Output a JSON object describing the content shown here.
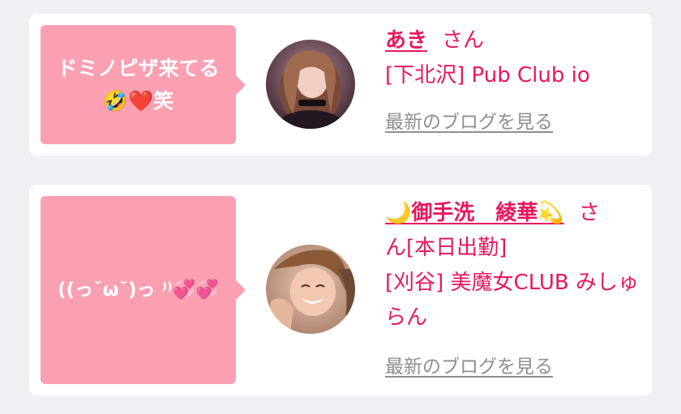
{
  "cards": [
    {
      "message": "ドミノピザ来てる\n🤣❤️笑",
      "name": "あき",
      "honorific": "さん",
      "shop": "[下北沢] Pub Club io",
      "blog_link": "最新のブログを見る",
      "avatar_icon": "woman-portrait-photo"
    },
    {
      "message": "((っ˘ω˘)っ‪ ⁾⁾💞💞",
      "name": "🌙御手洗　綾華💫",
      "honorific": "さ",
      "name_cont": "ん[本日出勤]",
      "shop": "[刈谷] 美魔女CLUB みしゅらん",
      "blog_link": "最新のブログを見る",
      "avatar_icon": "smiling-woman-photo"
    }
  ],
  "colors": {
    "bubble": "#fba0b2",
    "accent": "#e8185d",
    "link_gray": "#8e8e93"
  }
}
